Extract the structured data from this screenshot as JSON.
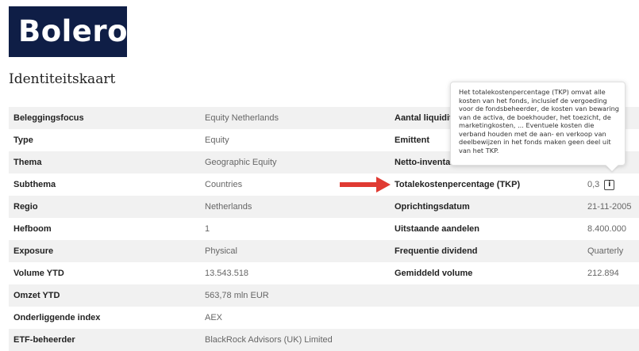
{
  "logo": {
    "text": "Bolero"
  },
  "page_title": "Identiteitskaart",
  "rows": [
    {
      "label1": "Beleggingsfocus",
      "value1": "Equity Netherlands",
      "label2": "Aantal liquiditei",
      "value2": ""
    },
    {
      "label1": "Type",
      "value1": "Equity",
      "label2": "Emittent",
      "value2": ""
    },
    {
      "label1": "Thema",
      "value1": "Geographic Equity",
      "label2": "Netto-inventaris",
      "value2": ""
    },
    {
      "label1": "Subthema",
      "value1": "Countries",
      "label2": "Totalekostenpercentage (TKP)",
      "value2": "0,3"
    },
    {
      "label1": "Regio",
      "value1": "Netherlands",
      "label2": "Oprichtingsdatum",
      "value2": "21-11-2005"
    },
    {
      "label1": "Hefboom",
      "value1": "1",
      "label2": "Uitstaande aandelen",
      "value2": "8.400.000"
    },
    {
      "label1": "Exposure",
      "value1": "Physical",
      "label2": "Frequentie dividend",
      "value2": "Quarterly"
    },
    {
      "label1": "Volume YTD",
      "value1": "13.543.518",
      "label2": "Gemiddeld volume",
      "value2": "212.894"
    },
    {
      "label1": "Omzet YTD",
      "value1": "563,78 mln EUR",
      "label2": "",
      "value2": ""
    },
    {
      "label1": "Onderliggende index",
      "value1": "AEX",
      "label2": "",
      "value2": ""
    },
    {
      "label1": "ETF-beheerder",
      "value1": "BlackRock Advisors (UK) Limited",
      "label2": "",
      "value2": ""
    }
  ],
  "info_icon": {
    "name": "info-icon",
    "glyph": "i"
  },
  "tooltip": {
    "text": "Het totalekostenpercentage (TKP) omvat alle kosten van het fonds, inclusief de vergoeding voor de fondsbeheerder, de kosten van bewaring van de activa, de boekhouder, het toezicht, de marketingkosten, ... Eventuele kosten die verband houden met de aan- en verkoop van deelbewijzen in het fonds maken geen deel uit van het TKP."
  },
  "colors": {
    "logo_bg": "#0f1e46",
    "row_shade": "#f1f1f1",
    "arrow": "#e03a32"
  }
}
